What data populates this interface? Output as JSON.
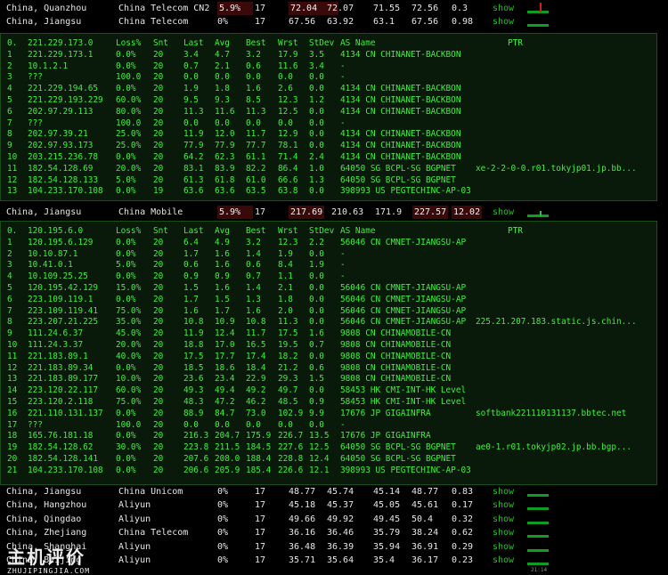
{
  "header_rows": [
    {
      "location": "China, Quanzhou",
      "isp": "China Telecom CN2",
      "loss": "5.9%",
      "snt": "17",
      "last": "72.04",
      "avg": "72.07",
      "best": "71.55",
      "wrst": "72.56",
      "stdev": "0.3",
      "show": "show"
    },
    {
      "location": "China, Jiangsu",
      "isp": "China Telecom",
      "loss": "0%",
      "snt": "17",
      "last": "67.56",
      "avg": "63.92",
      "best": "63.1",
      "wrst": "67.56",
      "stdev": "0.98",
      "show": "show"
    }
  ],
  "mtr1": {
    "header": {
      "num": "0.",
      "ip": "221.229.173.0",
      "loss": "Loss%",
      "snt": "Snt",
      "last": "Last",
      "avg": "Avg",
      "best": "Best",
      "wrst": "Wrst",
      "stdev": "StDev",
      "as": "AS Name",
      "ptr": "PTR"
    },
    "hops": [
      {
        "num": "1",
        "ip": "221.229.173.1",
        "loss": "0.0%",
        "snt": "20",
        "last": "3.4",
        "avg": "4.7",
        "best": "3.2",
        "wrst": "17.9",
        "stdev": "3.5",
        "as": "4134  CN  CHINANET-BACKBON",
        "ptr": ""
      },
      {
        "num": "2",
        "ip": "10.1.2.1",
        "loss": "0.0%",
        "snt": "20",
        "last": "0.7",
        "avg": "2.1",
        "best": "0.6",
        "wrst": "11.6",
        "stdev": "3.4",
        "as": "-",
        "ptr": ""
      },
      {
        "num": "3",
        "ip": "???",
        "loss": "100.0",
        "snt": "20",
        "last": "0.0",
        "avg": "0.0",
        "best": "0.0",
        "wrst": "0.0",
        "stdev": "0.0",
        "as": "-",
        "ptr": ""
      },
      {
        "num": "4",
        "ip": "221.229.194.65",
        "loss": "0.0%",
        "snt": "20",
        "last": "1.9",
        "avg": "1.8",
        "best": "1.6",
        "wrst": "2.6",
        "stdev": "0.0",
        "as": "4134  CN  CHINANET-BACKBON",
        "ptr": ""
      },
      {
        "num": "5",
        "ip": "221.229.193.229",
        "loss": "60.0%",
        "snt": "20",
        "last": "9.5",
        "avg": "9.3",
        "best": "8.5",
        "wrst": "12.3",
        "stdev": "1.2",
        "as": "4134  CN  CHINANET-BACKBON",
        "ptr": ""
      },
      {
        "num": "6",
        "ip": "202.97.29.113",
        "loss": "80.0%",
        "snt": "20",
        "last": "11.3",
        "avg": "11.6",
        "best": "11.3",
        "wrst": "12.5",
        "stdev": "0.0",
        "as": "4134  CN  CHINANET-BACKBON",
        "ptr": ""
      },
      {
        "num": "7",
        "ip": "???",
        "loss": "100.0",
        "snt": "20",
        "last": "0.0",
        "avg": "0.0",
        "best": "0.0",
        "wrst": "0.0",
        "stdev": "0.0",
        "as": "-",
        "ptr": ""
      },
      {
        "num": "8",
        "ip": "202.97.39.21",
        "loss": "25.0%",
        "snt": "20",
        "last": "11.9",
        "avg": "12.0",
        "best": "11.7",
        "wrst": "12.9",
        "stdev": "0.0",
        "as": "4134  CN  CHINANET-BACKBON",
        "ptr": ""
      },
      {
        "num": "9",
        "ip": "202.97.93.173",
        "loss": "25.0%",
        "snt": "20",
        "last": "77.9",
        "avg": "77.9",
        "best": "77.7",
        "wrst": "78.1",
        "stdev": "0.0",
        "as": "4134  CN  CHINANET-BACKBON",
        "ptr": ""
      },
      {
        "num": "10",
        "ip": "203.215.236.78",
        "loss": "0.0%",
        "snt": "20",
        "last": "64.2",
        "avg": "62.3",
        "best": "61.1",
        "wrst": "71.4",
        "stdev": "2.4",
        "as": "4134  CN  CHINANET-BACKBON",
        "ptr": ""
      },
      {
        "num": "11",
        "ip": "182.54.128.69",
        "loss": "20.0%",
        "snt": "20",
        "last": "83.1",
        "avg": "83.9",
        "best": "82.2",
        "wrst": "86.4",
        "stdev": "1.0",
        "as": "64050 SG  BCPL-SG BGPNET",
        "ptr": "xe-2-2-0-0.r01.tokyjp01.jp.bb..."
      },
      {
        "num": "12",
        "ip": "182.54.128.133",
        "loss": "5.0%",
        "snt": "20",
        "last": "61.3",
        "avg": "61.8",
        "best": "61.0",
        "wrst": "66.6",
        "stdev": "1.3",
        "as": "64050 SG  BCPL-SG BGPNET",
        "ptr": ""
      },
      {
        "num": "13",
        "ip": "104.233.170.108",
        "loss": "0.0%",
        "snt": "19",
        "last": "63.6",
        "avg": "63.6",
        "best": "63.5",
        "wrst": "63.8",
        "stdev": "0.0",
        "as": "398993 US PEGTECHINC-AP-03",
        "ptr": ""
      }
    ]
  },
  "middle_row": {
    "location": "China, Jiangsu",
    "isp": "China Mobile",
    "loss": "5.9%",
    "snt": "17",
    "last": "217.69",
    "avg": "210.63",
    "best": "171.9",
    "wrst": "227.57",
    "stdev": "12.02",
    "show": "show"
  },
  "mtr2": {
    "header": {
      "num": "0.",
      "ip": "120.195.6.0",
      "loss": "Loss%",
      "snt": "Snt",
      "last": "Last",
      "avg": "Avg",
      "best": "Best",
      "wrst": "Wrst",
      "stdev": "StDev",
      "as": "AS Name",
      "ptr": "PTR"
    },
    "hops": [
      {
        "num": "1",
        "ip": "120.195.6.129",
        "loss": "0.0%",
        "snt": "20",
        "last": "6.4",
        "avg": "4.9",
        "best": "3.2",
        "wrst": "12.3",
        "stdev": "2.2",
        "as": "56046 CN  CMNET-JIANGSU-AP",
        "ptr": ""
      },
      {
        "num": "2",
        "ip": "10.10.87.1",
        "loss": "0.0%",
        "snt": "20",
        "last": "1.7",
        "avg": "1.6",
        "best": "1.4",
        "wrst": "1.9",
        "stdev": "0.0",
        "as": "-",
        "ptr": ""
      },
      {
        "num": "3",
        "ip": "10.41.0.1",
        "loss": "5.0%",
        "snt": "20",
        "last": "0.6",
        "avg": "1.6",
        "best": "0.6",
        "wrst": "8.4",
        "stdev": "1.9",
        "as": "-",
        "ptr": ""
      },
      {
        "num": "4",
        "ip": "10.109.25.25",
        "loss": "0.0%",
        "snt": "20",
        "last": "0.9",
        "avg": "0.9",
        "best": "0.7",
        "wrst": "1.1",
        "stdev": "0.0",
        "as": "-",
        "ptr": ""
      },
      {
        "num": "5",
        "ip": "120.195.42.129",
        "loss": "15.0%",
        "snt": "20",
        "last": "1.5",
        "avg": "1.6",
        "best": "1.4",
        "wrst": "2.1",
        "stdev": "0.0",
        "as": "56046 CN  CMNET-JIANGSU-AP",
        "ptr": ""
      },
      {
        "num": "6",
        "ip": "223.109.119.1",
        "loss": "0.0%",
        "snt": "20",
        "last": "1.7",
        "avg": "1.5",
        "best": "1.3",
        "wrst": "1.8",
        "stdev": "0.0",
        "as": "56046 CN  CMNET-JIANGSU-AP",
        "ptr": ""
      },
      {
        "num": "7",
        "ip": "223.109.119.41",
        "loss": "75.0%",
        "snt": "20",
        "last": "1.6",
        "avg": "1.7",
        "best": "1.6",
        "wrst": "2.0",
        "stdev": "0.0",
        "as": "56046 CN  CMNET-JIANGSU-AP",
        "ptr": ""
      },
      {
        "num": "8",
        "ip": "223.207.21.225",
        "loss": "35.0%",
        "snt": "20",
        "last": "10.8",
        "avg": "10.9",
        "best": "10.8",
        "wrst": "11.3",
        "stdev": "0.0",
        "as": "56046 CN  CMNET-JIANGSU-AP",
        "ptr": "225.21.207.183.static.js.chin..."
      },
      {
        "num": "9",
        "ip": "111.24.6.37",
        "loss": "45.0%",
        "snt": "20",
        "last": "11.9",
        "avg": "12.4",
        "best": "11.7",
        "wrst": "17.5",
        "stdev": "1.6",
        "as": "9808  CN  CHINAMOBILE-CN",
        "ptr": ""
      },
      {
        "num": "10",
        "ip": "111.24.3.37",
        "loss": "20.0%",
        "snt": "20",
        "last": "18.8",
        "avg": "17.0",
        "best": "16.5",
        "wrst": "19.5",
        "stdev": "0.7",
        "as": "9808  CN  CHINAMOBILE-CN",
        "ptr": ""
      },
      {
        "num": "11",
        "ip": "221.183.89.1",
        "loss": "40.0%",
        "snt": "20",
        "last": "17.5",
        "avg": "17.7",
        "best": "17.4",
        "wrst": "18.2",
        "stdev": "0.0",
        "as": "9808  CN  CHINAMOBILE-CN",
        "ptr": ""
      },
      {
        "num": "12",
        "ip": "221.183.89.34",
        "loss": "0.0%",
        "snt": "20",
        "last": "18.5",
        "avg": "18.6",
        "best": "18.4",
        "wrst": "21.2",
        "stdev": "0.6",
        "as": "9808  CN  CHINAMOBILE-CN",
        "ptr": ""
      },
      {
        "num": "13",
        "ip": "221.183.89.177",
        "loss": "10.0%",
        "snt": "20",
        "last": "23.6",
        "avg": "23.4",
        "best": "22.9",
        "wrst": "29.3",
        "stdev": "1.5",
        "as": "9808  CN  CHINAMOBILE-CN",
        "ptr": ""
      },
      {
        "num": "14",
        "ip": "223.120.22.117",
        "loss": "60.0%",
        "snt": "20",
        "last": "49.3",
        "avg": "49.4",
        "best": "49.2",
        "wrst": "49.7",
        "stdev": "0.0",
        "as": "58453 HK  CMI-INT-HK Level",
        "ptr": ""
      },
      {
        "num": "15",
        "ip": "223.120.2.118",
        "loss": "75.0%",
        "snt": "20",
        "last": "48.3",
        "avg": "47.2",
        "best": "46.2",
        "wrst": "48.5",
        "stdev": "0.9",
        "as": "58453 HK  CMI-INT-HK Level",
        "ptr": ""
      },
      {
        "num": "16",
        "ip": "221.110.131.137",
        "loss": "0.0%",
        "snt": "20",
        "last": "88.9",
        "avg": "84.7",
        "best": "73.0",
        "wrst": "102.9",
        "stdev": "9.9",
        "as": "17676 JP  GIGAINFRA",
        "ptr": "softbank221110131137.bbtec.net"
      },
      {
        "num": "17",
        "ip": "???",
        "loss": "100.0",
        "snt": "20",
        "last": "0.0",
        "avg": "0.0",
        "best": "0.0",
        "wrst": "0.0",
        "stdev": "0.0",
        "as": "-",
        "ptr": ""
      },
      {
        "num": "18",
        "ip": "165.76.181.18",
        "loss": "0.0%",
        "snt": "20",
        "last": "216.3",
        "avg": "204.7",
        "best": "175.9",
        "wrst": "226.7",
        "stdev": "13.5",
        "as": "17676 JP  GIGAINFRA",
        "ptr": ""
      },
      {
        "num": "19",
        "ip": "182.54.128.62",
        "loss": "30.0%",
        "snt": "20",
        "last": "223.8",
        "avg": "211.5",
        "best": "184.5",
        "wrst": "227.6",
        "stdev": "12.5",
        "as": "64050 SG  BCPL-SG BGPNET",
        "ptr": "ae0-1.r01.tokyjp02.jp.bb.bgp..."
      },
      {
        "num": "20",
        "ip": "182.54.128.141",
        "loss": "0.0%",
        "snt": "20",
        "last": "207.6",
        "avg": "208.0",
        "best": "188.4",
        "wrst": "228.8",
        "stdev": "12.4",
        "as": "64050 SG  BCPL-SG BGPNET",
        "ptr": ""
      },
      {
        "num": "21",
        "ip": "104.233.170.108",
        "loss": "0.0%",
        "snt": "20",
        "last": "206.6",
        "avg": "205.9",
        "best": "185.4",
        "wrst": "226.6",
        "stdev": "12.1",
        "as": "398993 US PEGTECHINC-AP-03",
        "ptr": ""
      }
    ]
  },
  "bottom_rows": [
    {
      "location": "China, Jiangsu",
      "isp": "China Unicom",
      "loss": "0%",
      "snt": "17",
      "last": "48.77",
      "avg": "45.74",
      "best": "45.14",
      "wrst": "48.77",
      "stdev": "0.83",
      "show": "show"
    },
    {
      "location": "China, Hangzhou",
      "isp": "Aliyun",
      "loss": "0%",
      "snt": "17",
      "last": "45.18",
      "avg": "45.37",
      "best": "45.05",
      "wrst": "45.61",
      "stdev": "0.17",
      "show": "show"
    },
    {
      "location": "China, Qingdao",
      "isp": "Aliyun",
      "loss": "0%",
      "snt": "17",
      "last": "49.66",
      "avg": "49.92",
      "best": "49.45",
      "wrst": "50.4",
      "stdev": "0.32",
      "show": "show"
    },
    {
      "location": "China, Zhejiang",
      "isp": "China Telecom",
      "loss": "0%",
      "snt": "17",
      "last": "36.16",
      "avg": "36.46",
      "best": "35.79",
      "wrst": "38.24",
      "stdev": "0.62",
      "show": "show"
    },
    {
      "location": "China, Shanghai",
      "isp": "Aliyun",
      "loss": "0%",
      "snt": "17",
      "last": "36.48",
      "avg": "36.39",
      "best": "35.94",
      "wrst": "36.91",
      "stdev": "0.29",
      "show": "show"
    },
    {
      "location": "China, Beijing",
      "isp": "Aliyun",
      "loss": "0%",
      "snt": "17",
      "last": "35.71",
      "avg": "35.64",
      "best": "35.4",
      "wrst": "36.17",
      "stdev": "0.23",
      "show": "show"
    }
  ],
  "watermark": {
    "big": "主机评价",
    "small": "ZHUJIPINGJIA.COM"
  },
  "time_label": "21:14",
  "colors": {
    "accent": "#25c225",
    "mtr_text": "#3df03d",
    "loss_bg": "#3a0a0a"
  }
}
